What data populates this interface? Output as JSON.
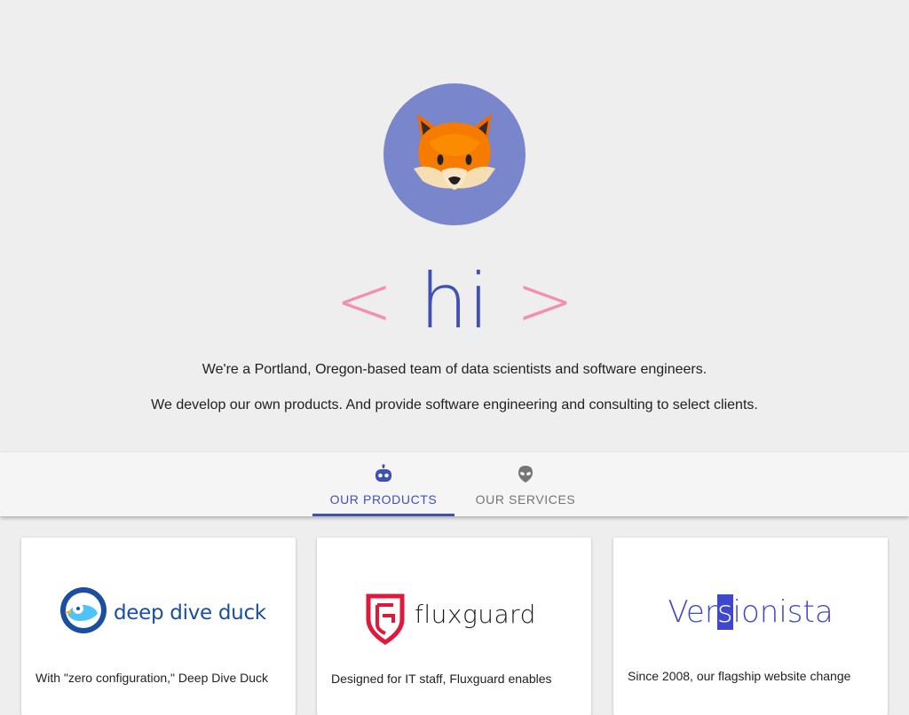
{
  "hero": {
    "avatar_icon": "fox-face-icon",
    "bracket_left": "<",
    "hi_text": "hi",
    "bracket_right": ">",
    "intro_line1": "We're a Portland, Oregon-based team of data scientists and software engineers.",
    "intro_line2": "We develop our own products. And provide software engineering and consulting to select clients.",
    "colors": {
      "avatar_bg": "#7986cb",
      "brackets": "#f48fb1",
      "hi": "#3f51b5"
    }
  },
  "tabs": [
    {
      "label": "OUR PRODUCTS",
      "icon": "robot-icon",
      "selected": true
    },
    {
      "label": "OUR SERVICES",
      "icon": "alien-icon",
      "selected": false
    }
  ],
  "products": [
    {
      "logo_text": "deep dive duck",
      "logo_icon": "duck-icon",
      "description": "With \"zero configuration,\" Deep Dive Duck"
    },
    {
      "logo_text": "fluxguard",
      "logo_icon": "shield-icon",
      "description": "Designed for IT staff, Fluxguard enables"
    },
    {
      "logo_text_a": "Ver",
      "logo_text_b": "s",
      "logo_text_c": "ionista",
      "description": "Since 2008, our flagship website change"
    }
  ],
  "accent_color": "#3f51b5"
}
